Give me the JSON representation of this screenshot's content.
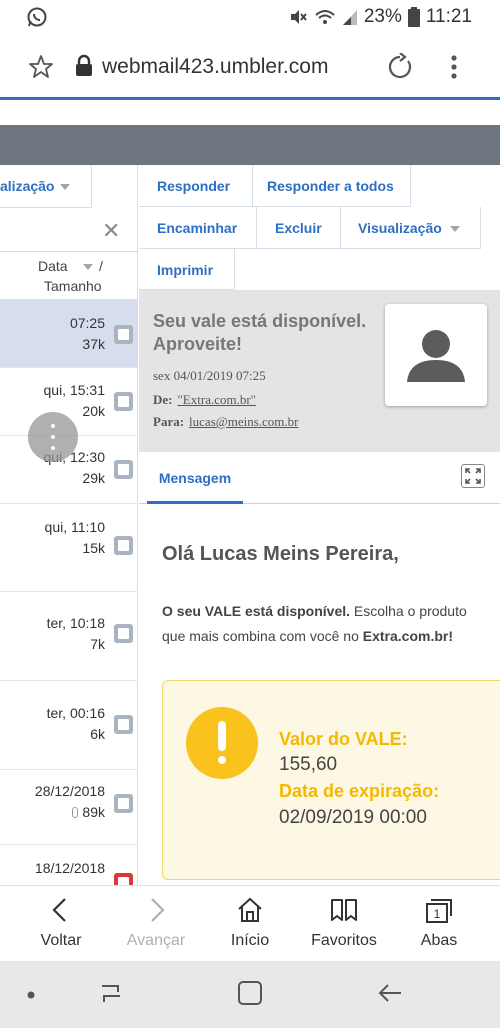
{
  "status_bar": {
    "battery_percent": "23%",
    "time": "11:21",
    "icons": [
      "whatsapp-icon",
      "mute-icon",
      "wifi-icon",
      "signal-icon",
      "battery-icon"
    ]
  },
  "browser": {
    "url": "webmail423.umbler.com"
  },
  "list_pane": {
    "view_label": "alização",
    "col_date": "Data",
    "col_slash": "/",
    "col_size": "Tamanho",
    "rows": [
      {
        "date": "07:25",
        "size": "37k",
        "selected": true,
        "flag_color": "#a9b3c2"
      },
      {
        "date": "qui, 15:31",
        "size": "20k",
        "selected": false,
        "flag_color": "#a9b3c2"
      },
      {
        "date": "qui, 12:30",
        "size": "29k",
        "selected": false,
        "flag_color": "#a9b3c2"
      },
      {
        "date": "qui, 11:10",
        "size": "15k",
        "selected": false,
        "flag_color": "#a9b3c2"
      },
      {
        "date": "ter, 10:18",
        "size": "7k",
        "selected": false,
        "flag_color": "#a9b3c2"
      },
      {
        "date": "ter, 00:16",
        "size": "6k",
        "selected": false,
        "flag_color": "#a9b3c2"
      },
      {
        "date": "28/12/2018",
        "size": "89k",
        "selected": false,
        "attachment": true,
        "flag_color": "#a9b3c2"
      },
      {
        "date": "18/12/2018",
        "size": "",
        "selected": false,
        "flag_color": "#d93a36"
      }
    ]
  },
  "toolbar": {
    "reply": "Responder",
    "reply_all": "Responder a todos",
    "forward": "Encaminhar",
    "delete": "Excluir",
    "view": "Visualização",
    "print": "Imprimir"
  },
  "message": {
    "subject": "Seu vale está disponível. Aproveite!",
    "date": "sex 04/01/2019 07:25",
    "from_label": "De:",
    "from_value": "\"Extra.com.br\"",
    "to_label": "Para:",
    "to_value": "lucas@meins.com.br",
    "tab_label": "Mensagem",
    "greeting": "Olá Lucas Meins Pereira,",
    "para_bold1": "O seu VALE está disponível.",
    "para_text1": " Escolha o produto",
    "para_text2": "que mais combina com você no ",
    "para_bold2": "Extra.com.br!",
    "voucher_label": "Valor do VALE:",
    "voucher_value": "155,60",
    "expiry_label": "Data de expiração:",
    "expiry_value": "02/09/2019 00:00"
  },
  "bottom_nav": {
    "back": "Voltar",
    "forward": "Avançar",
    "home": "Início",
    "favorites": "Favoritos",
    "tabs": "Abas",
    "tab_count": "1"
  },
  "colors": {
    "accent": "#2f6fc3",
    "selected_row": "#d6deed",
    "voucher_yellow": "#f5b800",
    "header_gray": "#e4e4e4"
  }
}
